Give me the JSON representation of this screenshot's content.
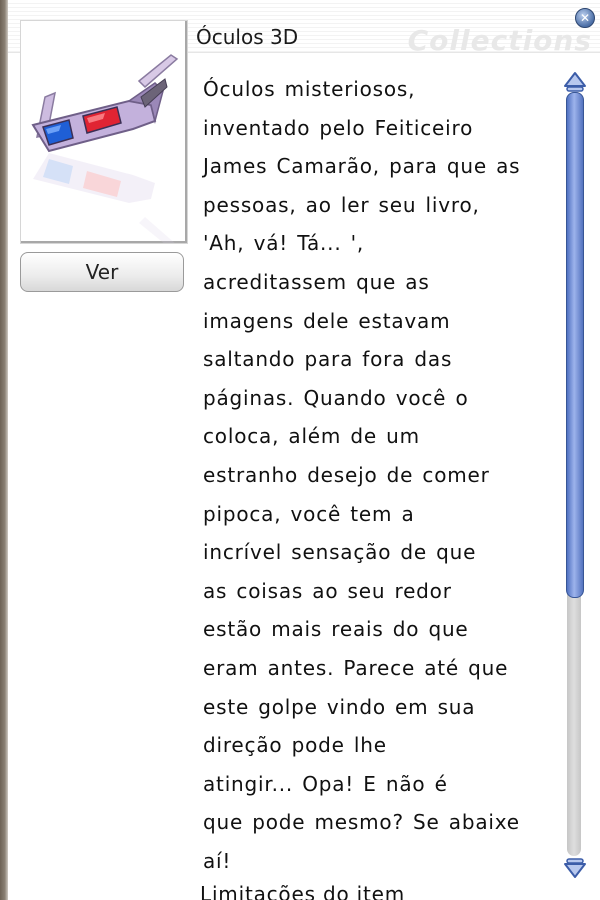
{
  "window": {
    "title": "Óculos 3D",
    "watermark": "Collections",
    "close_icon": "close-icon"
  },
  "item": {
    "image_icon": "3d-glasses",
    "view_button_label": "Ver",
    "description_lines": [
      "Óculos misteriosos,",
      "inventado pelo Feiticeiro",
      "James Camarão, para que as",
      "pessoas, ao ler seu livro,",
      "'Ah, vá! Tá... ',",
      "acreditassem que as",
      "imagens dele estavam",
      "saltando para fora das",
      "páginas. Quando você o",
      "coloca, além de um",
      "estranho desejo de comer",
      "pipoca, você tem a",
      "incrível sensação de que",
      "as coisas ao seu redor",
      "estão mais reais do que",
      "eram antes. Parece até que",
      "este golpe vindo em sua",
      "direção pode lhe",
      "atingir... Opa! E não é",
      "que pode mesmo? Se abaixe",
      "aí!"
    ],
    "limitations_label": "Limitações do item"
  },
  "scrollbar": {
    "position_fraction": 0.0,
    "visible_fraction": 0.66
  },
  "colors": {
    "accent": "#5b7ccc",
    "close_button": "#4b6ea6"
  }
}
